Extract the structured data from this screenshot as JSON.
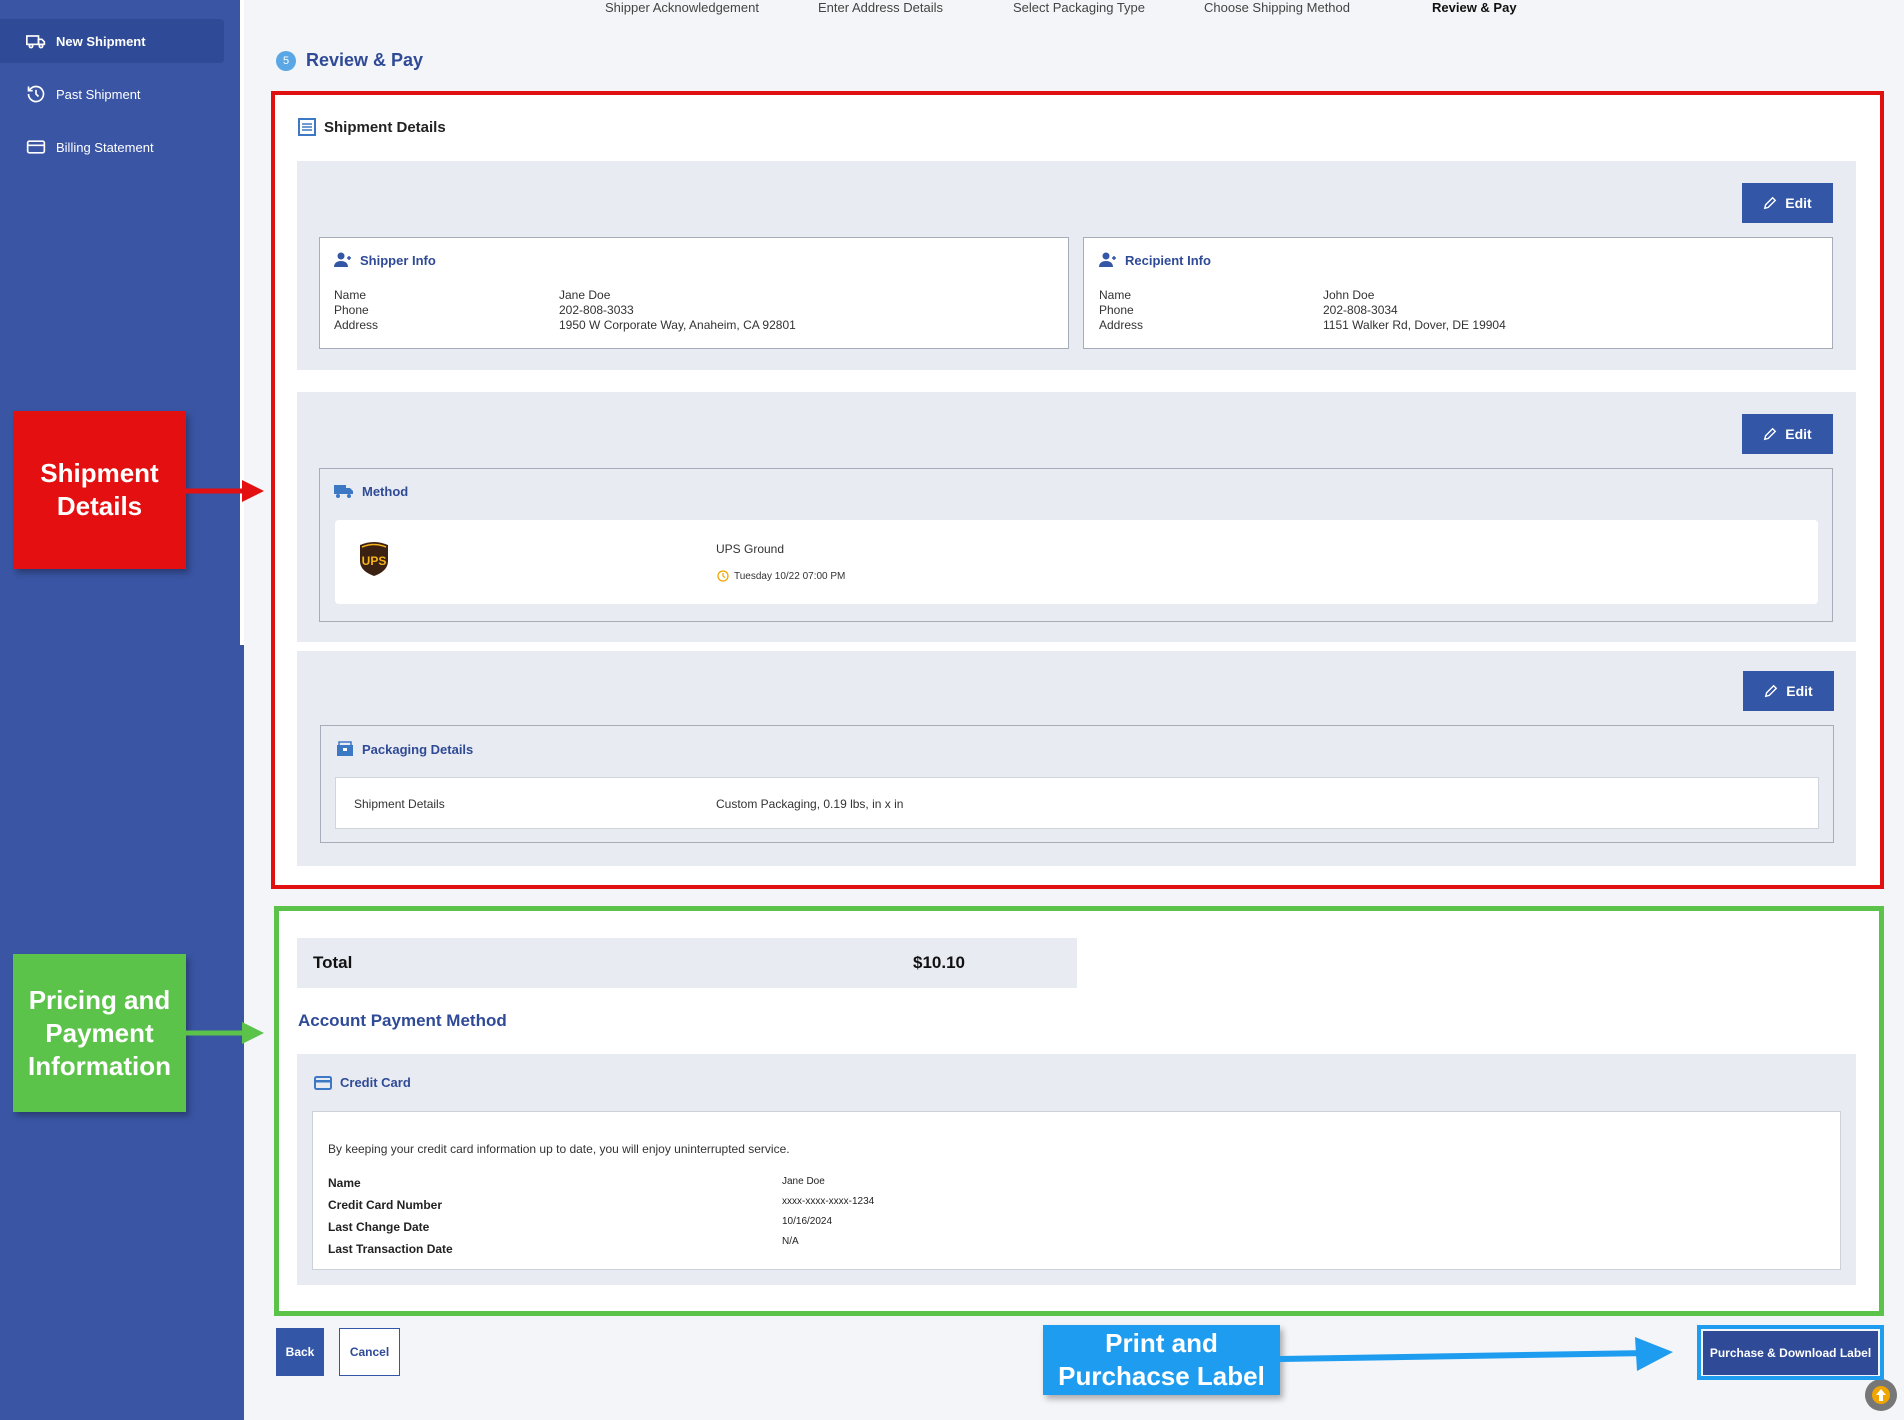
{
  "sidebar": {
    "items": [
      {
        "label": "New Shipment",
        "icon": "truck-icon",
        "active": true
      },
      {
        "label": "Past Shipment",
        "icon": "history-icon",
        "active": false
      },
      {
        "label": "Billing Statement",
        "icon": "credit-card-icon",
        "active": false
      }
    ]
  },
  "stepper": {
    "steps": [
      {
        "label": "Shipper Acknowledgement"
      },
      {
        "label": "Enter Address Details"
      },
      {
        "label": "Select Packaging Type"
      },
      {
        "label": "Choose Shipping Method"
      },
      {
        "label": "Review & Pay",
        "active": true
      }
    ]
  },
  "page": {
    "step_number": "5",
    "title": "Review & Pay"
  },
  "shipment_details": {
    "heading": "Shipment Details",
    "edit_label": "Edit",
    "shipper": {
      "title": "Shipper Info",
      "labels": [
        "Name",
        "Phone",
        "Address"
      ],
      "name": "Jane Doe",
      "phone": "202-808-3033",
      "address": "1950 W Corporate Way, Anaheim, CA 92801"
    },
    "recipient": {
      "title": "Recipient Info",
      "labels": [
        "Name",
        "Phone",
        "Address"
      ],
      "name": "John Doe",
      "phone": "202-808-3034",
      "address": "1151 Walker Rd, Dover, DE 19904"
    },
    "method": {
      "title": "Method",
      "carrier_logo": "UPS",
      "service": "UPS Ground",
      "delivery": "Tuesday 10/22 07:00 PM"
    },
    "packaging": {
      "title": "Packaging Details",
      "row_label": "Shipment Details",
      "row_value": "Custom Packaging, 0.19 lbs, in x in"
    }
  },
  "pricing": {
    "total_label": "Total",
    "total_value": "$10.10",
    "payment_heading": "Account Payment Method",
    "card_title": "Credit Card",
    "notice": "By keeping your credit card information up to date, you will enjoy uninterrupted service.",
    "fields": [
      {
        "label": "Name",
        "value": "Jane Doe"
      },
      {
        "label": "Credit Card Number",
        "value": "xxxx-xxxx-xxxx-1234"
      },
      {
        "label": "Last Change Date",
        "value": "10/16/2024"
      },
      {
        "label": "Last Transaction Date",
        "value": "N/A"
      }
    ]
  },
  "actions": {
    "back": "Back",
    "cancel": "Cancel",
    "purchase": "Purchase & Download Label"
  },
  "annotations": {
    "shipment": "Shipment Details",
    "pricing": "Pricing and Payment Information",
    "print": "Print and Purchacse Label"
  },
  "colors": {
    "sidebar": "#3a55a4",
    "primary": "#3356a7",
    "annotation_red": "#e40f10",
    "annotation_green": "#5cc34a",
    "annotation_blue": "#1e9cf0"
  }
}
